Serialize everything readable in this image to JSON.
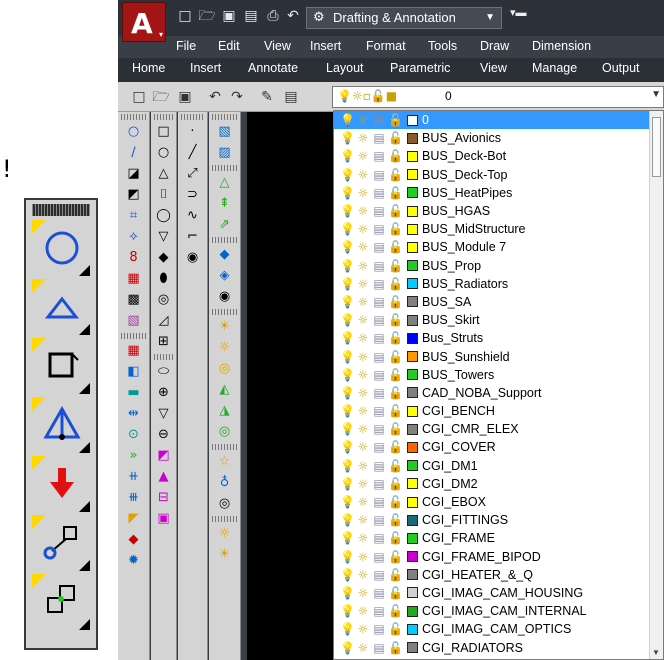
{
  "annotation": {
    "exclaim": "!"
  },
  "app": {
    "logo_letter": "A",
    "workspace": "Drafting & Annotation",
    "menus": [
      "File",
      "Edit",
      "View",
      "Insert",
      "Format",
      "Tools",
      "Draw",
      "Dimension"
    ],
    "ribbon_tabs": [
      "Home",
      "Insert",
      "Annotate",
      "Layout",
      "Parametric",
      "View",
      "Manage",
      "Output"
    ],
    "current_layer": "0"
  },
  "layers": [
    {
      "name": "0",
      "color": "#ffffff",
      "selected": true
    },
    {
      "name": "BUS_Avionics",
      "color": "#8b5a2b"
    },
    {
      "name": "BUS_Deck-Bot",
      "color": "#ffff00"
    },
    {
      "name": "BUS_Deck-Top",
      "color": "#ffff00"
    },
    {
      "name": "BUS_HeatPipes",
      "color": "#22cc22"
    },
    {
      "name": "BUS_HGAS",
      "color": "#ffff00"
    },
    {
      "name": "BUS_MidStructure",
      "color": "#ffff00"
    },
    {
      "name": "BUS_Module 7",
      "color": "#ffff00"
    },
    {
      "name": "BUS_Prop",
      "color": "#22cc22"
    },
    {
      "name": "BUS_Radiators",
      "color": "#00ccff"
    },
    {
      "name": "BUS_SA",
      "color": "#808080"
    },
    {
      "name": "BUS_Skirt",
      "color": "#808080"
    },
    {
      "name": "Bus_Struts",
      "color": "#0000ff"
    },
    {
      "name": "BUS_Sunshield",
      "color": "#ff9900"
    },
    {
      "name": "BUS_Towers",
      "color": "#22cc22"
    },
    {
      "name": "CAD_NOBA_Support",
      "color": "#808080"
    },
    {
      "name": "CGI_BENCH",
      "color": "#ffff00"
    },
    {
      "name": "CGI_CMR_ELEX",
      "color": "#808080"
    },
    {
      "name": "CGI_COVER",
      "color": "#ff6600"
    },
    {
      "name": "CGI_DM1",
      "color": "#22cc22"
    },
    {
      "name": "CGI_DM2",
      "color": "#ffff00"
    },
    {
      "name": "CGI_EBOX",
      "color": "#ffff00"
    },
    {
      "name": "CGI_FITTINGS",
      "color": "#1a6b7a"
    },
    {
      "name": "CGI_FRAME",
      "color": "#22cc22"
    },
    {
      "name": "CGI_FRAME_BIPOD",
      "color": "#cc00cc"
    },
    {
      "name": "CGI_HEATER_&_Q",
      "color": "#808080"
    },
    {
      "name": "CGI_IMAG_CAM_HOUSING",
      "color": "#d0d0d0"
    },
    {
      "name": "CGI_IMAG_CAM_INTERNAL",
      "color": "#22aa22"
    },
    {
      "name": "CGI_IMAG_CAM_OPTICS",
      "color": "#00ccff"
    },
    {
      "name": "CGI_RADIATORS",
      "color": "#808080"
    }
  ]
}
